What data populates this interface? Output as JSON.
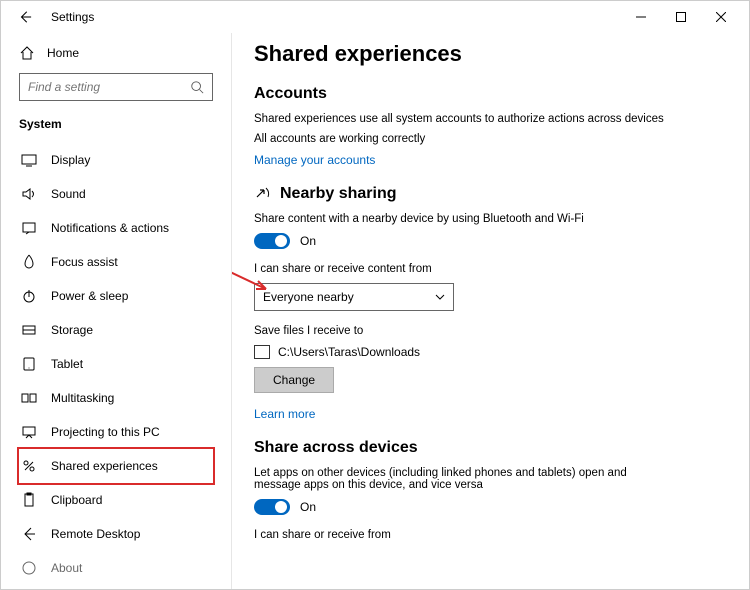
{
  "window": {
    "title": "Settings"
  },
  "sidebar": {
    "home": "Home",
    "search_placeholder": "Find a setting",
    "category": "System",
    "items": [
      {
        "label": "Display"
      },
      {
        "label": "Sound"
      },
      {
        "label": "Notifications & actions"
      },
      {
        "label": "Focus assist"
      },
      {
        "label": "Power & sleep"
      },
      {
        "label": "Storage"
      },
      {
        "label": "Tablet"
      },
      {
        "label": "Multitasking"
      },
      {
        "label": "Projecting to this PC"
      },
      {
        "label": "Shared experiences"
      },
      {
        "label": "Clipboard"
      },
      {
        "label": "Remote Desktop"
      },
      {
        "label": "About"
      }
    ]
  },
  "content": {
    "title": "Shared experiences",
    "accounts": {
      "heading": "Accounts",
      "desc": "Shared experiences use all system accounts to authorize actions across devices",
      "status": "All accounts are working correctly",
      "manage": "Manage your accounts"
    },
    "nearby": {
      "heading": "Nearby sharing",
      "desc": "Share content with a nearby device by using Bluetooth and Wi-Fi",
      "toggle_state": "On",
      "from_label": "I can share or receive content from",
      "from_value": "Everyone nearby",
      "save_label": "Save files I receive to",
      "save_path": "C:\\Users\\Taras\\Downloads",
      "change": "Change",
      "learn": "Learn more"
    },
    "across": {
      "heading": "Share across devices",
      "desc": "Let apps on other devices (including linked phones and tablets) open and message apps on this device, and vice versa",
      "toggle_state": "On",
      "from_label": "I can share or receive from"
    }
  }
}
